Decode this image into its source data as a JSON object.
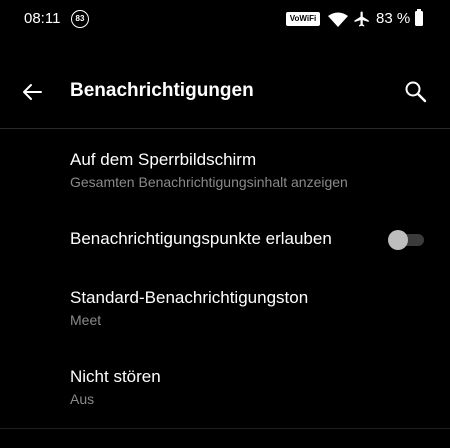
{
  "status_bar": {
    "time": "08:11",
    "notification_count": "83",
    "vowifi_label": "VoWiFi",
    "battery_text": "83 %",
    "icons": [
      "wifi-icon",
      "airplane-icon",
      "battery-icon"
    ]
  },
  "toolbar": {
    "title": "Benachrichtigungen",
    "back_icon": "arrow-left-icon",
    "search_icon": "search-icon"
  },
  "settings": [
    {
      "title": "Auf dem Sperrbildschirm",
      "summary": "Gesamten Benachrichtigungsinhalt anzeigen"
    },
    {
      "title": "Benachrichtigungspunkte erlauben",
      "toggle": false
    },
    {
      "title": "Standard-Benachrichtigungston",
      "summary": "Meet"
    },
    {
      "title": "Nicht stören",
      "summary": "Aus"
    }
  ],
  "colors": {
    "background": "#000000",
    "text_primary": "#ffffff",
    "text_secondary": "#8a8a8a",
    "toggle_off_thumb": "#bdbdbd",
    "toggle_off_track": "#3b3b3b"
  }
}
